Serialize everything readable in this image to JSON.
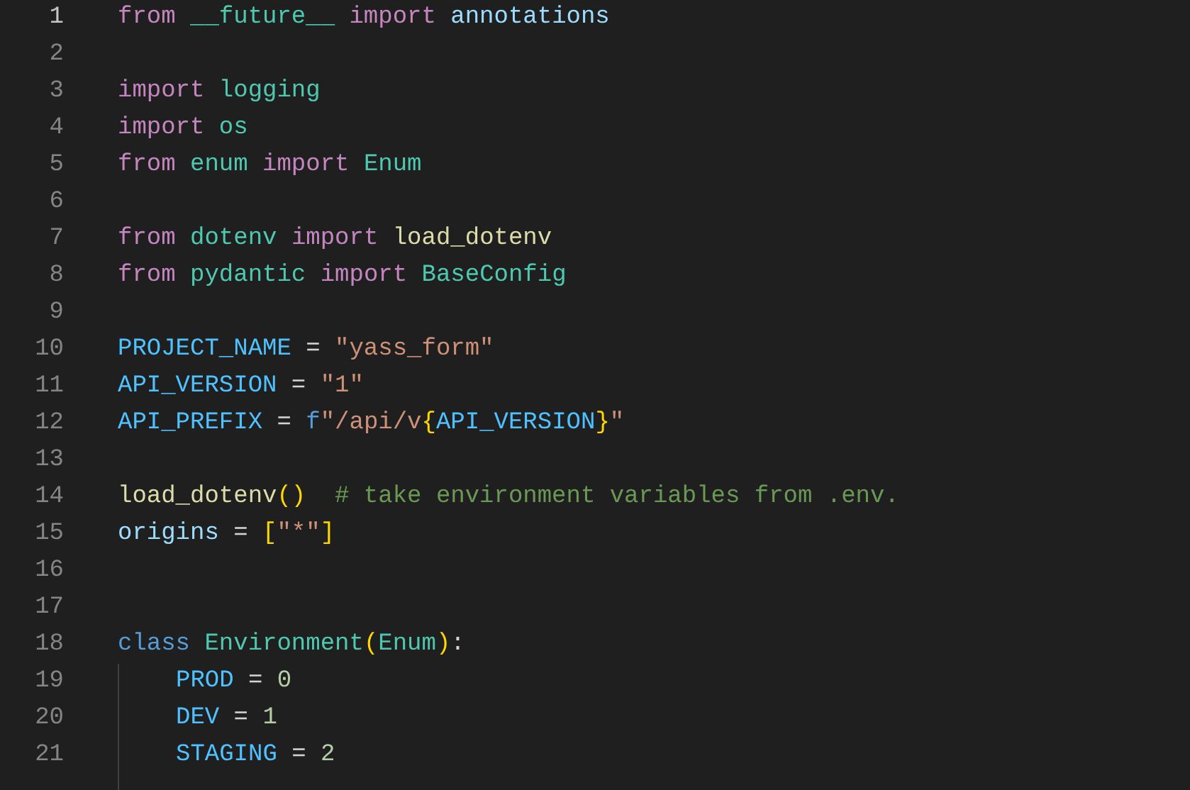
{
  "editor": {
    "lines": [
      {
        "number": "1",
        "active": true,
        "tokens": [
          {
            "text": "from ",
            "kind": "keyword"
          },
          {
            "text": "__future__ ",
            "kind": "module"
          },
          {
            "text": "import ",
            "kind": "keyword"
          },
          {
            "text": "annotations",
            "kind": "variable"
          }
        ]
      },
      {
        "number": "2",
        "active": false
      },
      {
        "number": "3",
        "active": false,
        "tokens": [
          {
            "text": "import ",
            "kind": "keyword"
          },
          {
            "text": "logging",
            "kind": "module"
          }
        ]
      },
      {
        "number": "4",
        "active": false,
        "tokens": [
          {
            "text": "import ",
            "kind": "keyword"
          },
          {
            "text": "os",
            "kind": "module"
          }
        ]
      },
      {
        "number": "5",
        "active": false,
        "tokens": [
          {
            "text": "from ",
            "kind": "keyword"
          },
          {
            "text": "enum ",
            "kind": "module"
          },
          {
            "text": "import ",
            "kind": "keyword"
          },
          {
            "text": "Enum",
            "kind": "module"
          }
        ]
      },
      {
        "number": "6",
        "active": false
      },
      {
        "number": "7",
        "active": false,
        "tokens": [
          {
            "text": "from ",
            "kind": "keyword"
          },
          {
            "text": "dotenv ",
            "kind": "module"
          },
          {
            "text": "import ",
            "kind": "keyword"
          },
          {
            "text": "load_dotenv",
            "kind": "function"
          }
        ]
      },
      {
        "number": "8",
        "active": false,
        "tokens": [
          {
            "text": "from ",
            "kind": "keyword"
          },
          {
            "text": "pydantic ",
            "kind": "module"
          },
          {
            "text": "import ",
            "kind": "keyword"
          },
          {
            "text": "BaseConfig",
            "kind": "module"
          }
        ]
      },
      {
        "number": "9",
        "active": false
      },
      {
        "number": "10",
        "active": false,
        "tokens": [
          {
            "text": "PROJECT_NAME",
            "kind": "constant"
          },
          {
            "text": " = ",
            "kind": "plain"
          },
          {
            "text": "\"yass_form\"",
            "kind": "string"
          }
        ]
      },
      {
        "number": "11",
        "active": false,
        "tokens": [
          {
            "text": "API_VERSION",
            "kind": "constant"
          },
          {
            "text": " = ",
            "kind": "plain"
          },
          {
            "text": "\"1\"",
            "kind": "string"
          }
        ]
      },
      {
        "number": "12",
        "active": false,
        "tokens": [
          {
            "text": "API_PREFIX",
            "kind": "constant"
          },
          {
            "text": " = ",
            "kind": "plain"
          },
          {
            "text": "f",
            "kind": "storage"
          },
          {
            "text": "\"/api/v",
            "kind": "string"
          },
          {
            "text": "{",
            "kind": "bracket"
          },
          {
            "text": "API_VERSION",
            "kind": "constant"
          },
          {
            "text": "}",
            "kind": "bracket"
          },
          {
            "text": "\"",
            "kind": "string"
          }
        ]
      },
      {
        "number": "13",
        "active": false
      },
      {
        "number": "14",
        "active": false,
        "tokens": [
          {
            "text": "load_dotenv",
            "kind": "function"
          },
          {
            "text": "()",
            "kind": "bracket"
          },
          {
            "text": "  # take environment variables from .env.",
            "kind": "comment"
          }
        ]
      },
      {
        "number": "15",
        "active": false,
        "tokens": [
          {
            "text": "origins",
            "kind": "variable"
          },
          {
            "text": " = ",
            "kind": "plain"
          },
          {
            "text": "[",
            "kind": "bracket"
          },
          {
            "text": "\"*\"",
            "kind": "string"
          },
          {
            "text": "]",
            "kind": "bracket"
          }
        ]
      },
      {
        "number": "16",
        "active": false
      },
      {
        "number": "17",
        "active": false
      },
      {
        "number": "18",
        "active": false,
        "tokens": [
          {
            "text": "class ",
            "kind": "storage"
          },
          {
            "text": "Environment",
            "kind": "module"
          },
          {
            "text": "(",
            "kind": "bracket"
          },
          {
            "text": "Enum",
            "kind": "module"
          },
          {
            "text": ")",
            "kind": "bracket"
          },
          {
            "text": ":",
            "kind": "plain"
          }
        ],
        "children": [
          {
            "number": "19",
            "active": false,
            "tokens": [
              {
                "text": "PROD",
                "kind": "constant"
              },
              {
                "text": " = ",
                "kind": "plain"
              },
              {
                "text": "0",
                "kind": "number"
              }
            ]
          },
          {
            "number": "20",
            "active": false,
            "tokens": [
              {
                "text": "DEV",
                "kind": "constant"
              },
              {
                "text": " = ",
                "kind": "plain"
              },
              {
                "text": "1",
                "kind": "number"
              }
            ]
          },
          {
            "number": "21",
            "active": false,
            "tokens": [
              {
                "text": "STAGING",
                "kind": "constant"
              },
              {
                "text": " = ",
                "kind": "plain"
              },
              {
                "text": "2",
                "kind": "number"
              }
            ]
          }
        ]
      }
    ]
  }
}
